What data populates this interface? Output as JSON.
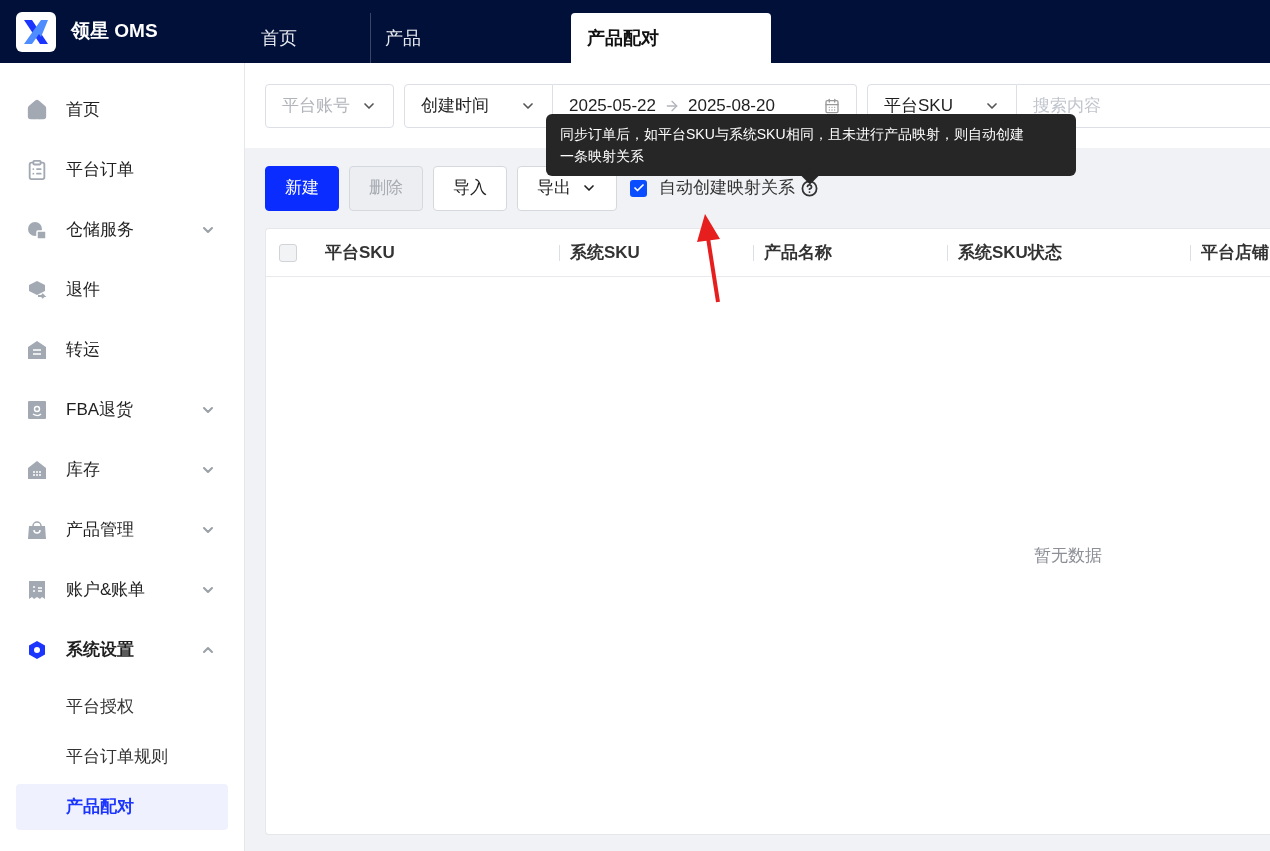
{
  "app": {
    "logo_text": "领星 OMS"
  },
  "tabs": [
    {
      "label": "首页",
      "selected": false
    },
    {
      "label": "产品",
      "selected": false
    },
    {
      "label": "产品配对",
      "selected": true
    }
  ],
  "sidebar": {
    "items": [
      {
        "label": "首页",
        "selected": false
      },
      {
        "label": "平台订单",
        "selected": false
      },
      {
        "label": "仓储服务",
        "selected": false,
        "expanded": false
      },
      {
        "label": "退件",
        "selected": false
      },
      {
        "label": "转运",
        "selected": false
      },
      {
        "label": "FBA退货",
        "selected": false,
        "expanded": false
      },
      {
        "label": "库存",
        "selected": false,
        "expanded": false
      },
      {
        "label": "产品管理",
        "selected": false,
        "expanded": false
      },
      {
        "label": "账户&账单",
        "selected": false,
        "expanded": false
      },
      {
        "label": "系统设置",
        "selected": true,
        "expanded": true,
        "children": [
          {
            "label": "平台授权",
            "selected": false
          },
          {
            "label": "平台订单规则",
            "selected": false
          },
          {
            "label": "产品配对",
            "selected": true
          }
        ]
      }
    ]
  },
  "filters": {
    "account": {
      "placeholder": "平台账号"
    },
    "time_type": {
      "value": "创建时间"
    },
    "date_range": {
      "start": "2025-05-22",
      "end": "2025-08-20"
    },
    "search_type": {
      "value": "平台SKU"
    },
    "search": {
      "placeholder": "搜索内容"
    }
  },
  "toolbar": {
    "buttons": [
      {
        "label": "新建",
        "kind": "primary",
        "disabled": false
      },
      {
        "label": "删除",
        "kind": "default",
        "disabled": true
      },
      {
        "label": "导入",
        "kind": "default",
        "disabled": false
      },
      {
        "label": "导出",
        "kind": "dropdown",
        "disabled": false
      }
    ],
    "auto_create": {
      "label": "自动创建映射关系",
      "checked": true
    },
    "tooltip": "同步订单后，如平台SKU与系统SKU相同，且未进行产品映射，则自动创建一条映射关系"
  },
  "table": {
    "select_all": {
      "checked": false
    },
    "columns": [
      "平台SKU",
      "系统SKU",
      "产品名称",
      "系统SKU状态",
      "平台店铺"
    ],
    "empty_text": "暂无数据"
  }
}
